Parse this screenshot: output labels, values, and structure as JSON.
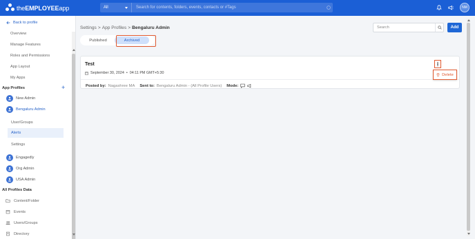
{
  "app": {
    "logo_prefix": "the",
    "logo_bold": "EMPLOYEE",
    "logo_suffix": "app",
    "brand_color": "#1b5fd6"
  },
  "topbar": {
    "scope": "All",
    "search_placeholder": "Search for contents, folders, events, contacts or #Tags",
    "avatar_initials": "NM",
    "icons": [
      "bell-icon",
      "megaphone-icon",
      "avatar"
    ]
  },
  "sidebar": {
    "back": "Back to profile",
    "items": [
      "Overview",
      "Manage Features",
      "Roles and Permissions",
      "App Layout",
      "My Apps"
    ],
    "app_profiles_heading": "App Profiles",
    "profiles": [
      {
        "label": "New Admin",
        "active": false
      },
      {
        "label": "Bengaluru Admin",
        "active": true
      },
      {
        "label": "Engagedly",
        "active": false
      },
      {
        "label": "Org Admin",
        "active": false
      },
      {
        "label": "USA Admin",
        "active": false
      }
    ],
    "sub_items": [
      "User/Groups",
      "Alerts",
      "Settings"
    ],
    "all_data_heading": "All Profiles Data",
    "data_items": [
      {
        "label": "Content/Folder",
        "icon": "folder-icon"
      },
      {
        "label": "Events",
        "icon": "calendar-icon"
      },
      {
        "label": "Users/Groups",
        "icon": "users-icon"
      },
      {
        "label": "Directory",
        "icon": "directory-icon"
      }
    ]
  },
  "main": {
    "breadcrumb": [
      "Settings",
      "App Profiles",
      "Bengaluru Admin"
    ],
    "search_placeholder": "Search",
    "add_label": "Add",
    "tabs": [
      "Published",
      "Archived"
    ],
    "active_tab": "Archived",
    "card": {
      "title": "Test",
      "date": "September 30, 2024",
      "time": "04:11 PM GMT+5:30",
      "posted_by_label": "Posted by:",
      "posted_by": "Nagashree MA",
      "sent_to_label": "Sent to:",
      "sent_to": "Bengaluru Admin - (All Profile Users)",
      "mode_label": "Mode:"
    },
    "delete_label": "Delete",
    "highlight_color": "#e0592f"
  }
}
